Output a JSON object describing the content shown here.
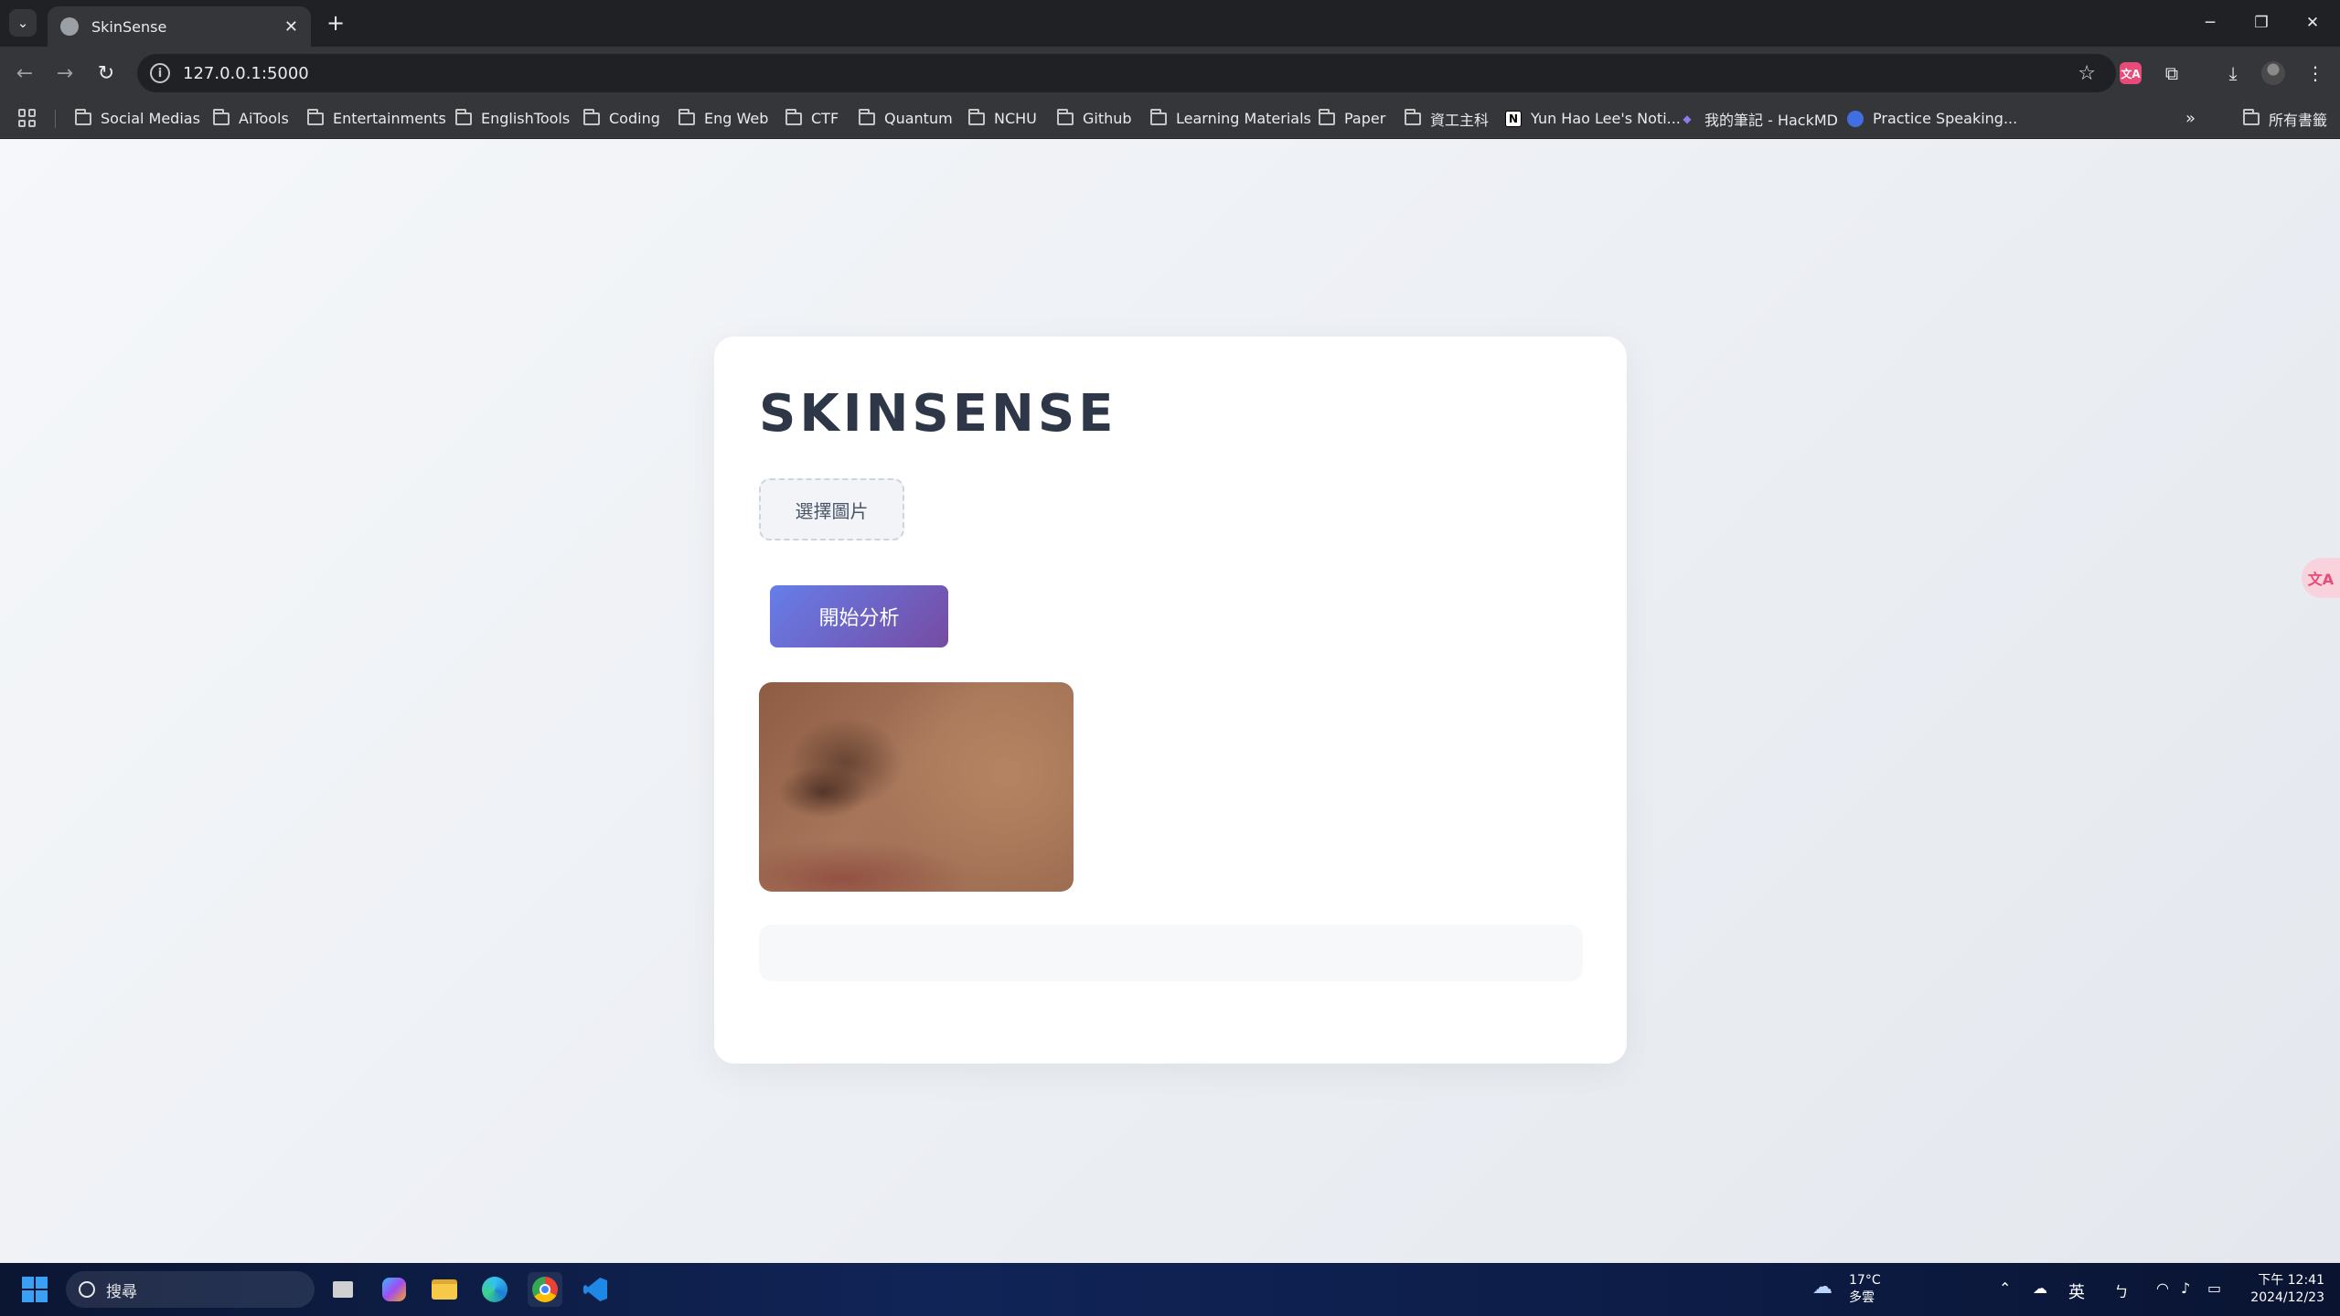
{
  "browser": {
    "tab_title": "SkinSense",
    "url": "127.0.0.1:5000",
    "bookmarks": [
      "Social Medias",
      "AiTools",
      "Entertainments",
      "EnglishTools",
      "Coding",
      "Eng Web",
      "CTF",
      "Quantum",
      "NCHU",
      "Github",
      "Learning Materials",
      "Paper",
      "資工主科"
    ],
    "bookmark_links": [
      "Yun Hao Lee's Noti...",
      "我的筆記 - HackMD",
      "Practice Speaking..."
    ],
    "all_bookmarks_label": "所有書籤"
  },
  "page": {
    "title": "SKINSENSE",
    "choose_image_label": "選擇圖片",
    "analyze_label": "開始分析",
    "result_text": ""
  },
  "taskbar": {
    "search_placeholder": "搜尋",
    "weather_temp": "17°C",
    "weather_desc": "多雲",
    "ime_label": "英",
    "time": "下午 12:41",
    "date": "2024/12/23"
  },
  "colors": {
    "accent_start": "#667eea",
    "accent_end": "#764ba2",
    "title": "#2d3748"
  }
}
